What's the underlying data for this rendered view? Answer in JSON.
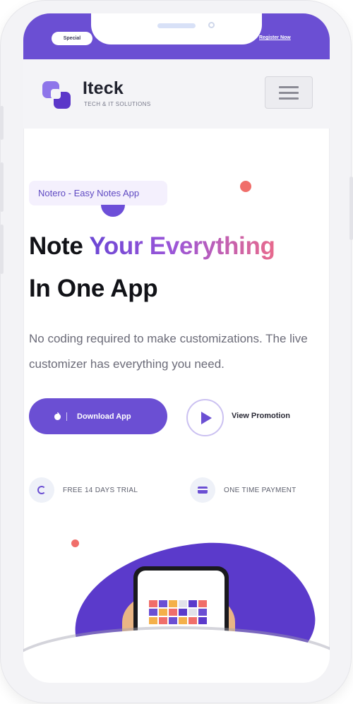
{
  "topbar": {
    "special_badge": "Special",
    "register_link": "Register Now"
  },
  "header": {
    "brand": "Iteck",
    "tagline": "TECH & IT SOLUTIONS",
    "menu_icon": "hamburger-menu-icon"
  },
  "hero": {
    "pill": "Notero - Easy Notes App",
    "title_part1": "Note ",
    "title_highlight": "Your Everything",
    "title_line2": "In One App",
    "description": "No coding required to make customizations. The live customizer has everything you need.",
    "download_button": "Download App",
    "view_promotion": "View Promotion"
  },
  "features": [
    {
      "label": "FREE 14 DAYS TRIAL",
      "icon": "refresh-icon"
    },
    {
      "label": "ONE TIME PAYMENT",
      "icon": "credit-card-icon"
    }
  ],
  "colors": {
    "primary": "#6b4fd3",
    "accent_dot": "#f06e6a",
    "gradient_end": "#e86a8c"
  }
}
